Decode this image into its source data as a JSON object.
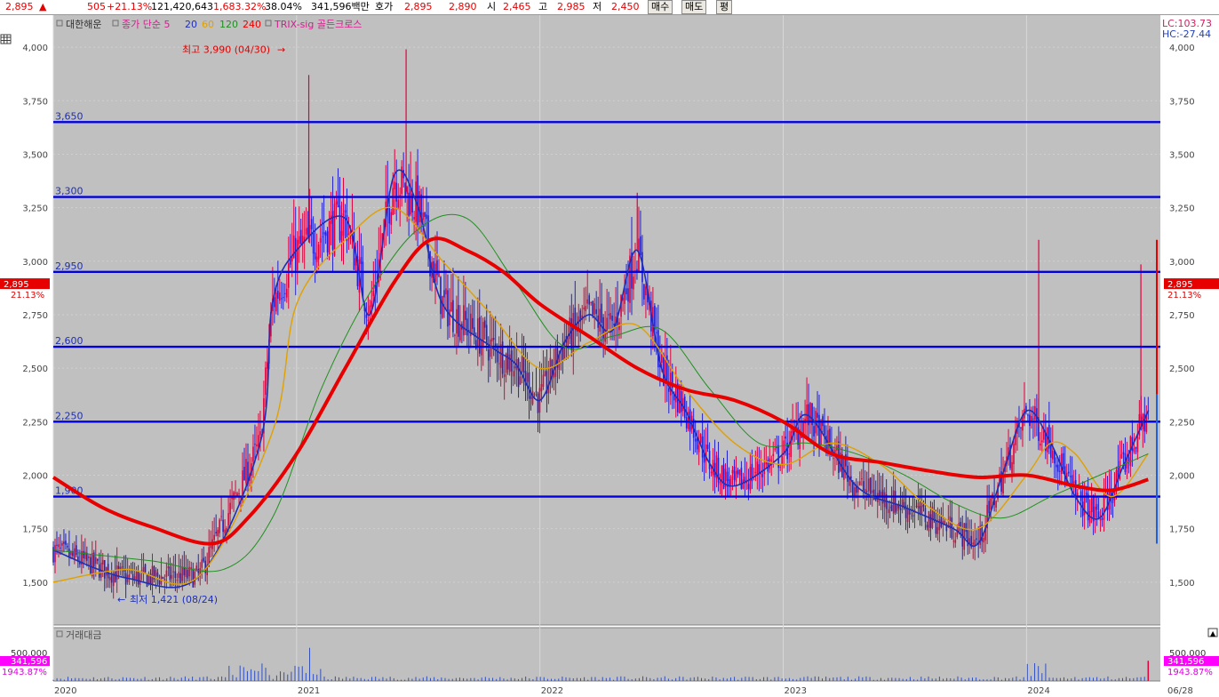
{
  "topbar": {
    "price": "2,895",
    "arrow": "▲",
    "change": "505",
    "change_pct": "+21.13%",
    "volume": "121,420,643",
    "volume_pct": "1,683.32%",
    "turnover": "38.04%",
    "amount": "341,596백만",
    "quote_label": "호가",
    "ask": "2,895",
    "bid": "2,890",
    "open_label": "시",
    "open": "2,465",
    "high_label": "고",
    "high": "2,985",
    "low_label": "저",
    "low": "2,450",
    "buy_button": "매수",
    "sell_button": "매도",
    "eval_button": "평"
  },
  "legend": {
    "stock_name": "대한해운",
    "ma_label": "종가 단순 5",
    "ma20": "20",
    "ma60": "60",
    "ma120": "120",
    "ma240": "240",
    "indicator": "TRIX-sig 골든크로스"
  },
  "right_info": {
    "lc": "LC:103.73",
    "hc": "HC:-27.44"
  },
  "current_tag": {
    "price": "2,895",
    "pct": "21.13%"
  },
  "volume_panel": {
    "title": "거래대금",
    "tick": "500,000",
    "current": "341,596",
    "pct": "1943.87%"
  },
  "annotations": {
    "high_label": "최고 3,990 (04/30)",
    "low_label": "최저 1,421 (08/24)"
  },
  "colors": {
    "background": "#c0c0c0",
    "candle_up": "#e0003c",
    "candle_down": "#2020d0",
    "ma5": "#1e2fb5",
    "ma20": "#e0a000",
    "ma60": "#209020",
    "ma240": "#e80000",
    "hline": "#0000e0",
    "tag": "#e60000"
  },
  "chart_data": {
    "type": "line",
    "title": "대한해운",
    "x_ticks": [
      "2020",
      "2021",
      "2022",
      "2023",
      "2024",
      "06/28"
    ],
    "y_ticks": [
      "4,000",
      "3,750",
      "3,500",
      "3,250",
      "3,000",
      "2,750",
      "2,500",
      "2,250",
      "2,000",
      "1,750",
      "1,500"
    ],
    "ylim": [
      1300,
      4150
    ],
    "horizontal_lines": [
      3650,
      3300,
      2950,
      2600,
      2250,
      1900
    ],
    "horizontal_line_labels": [
      "3,650",
      "3,300",
      "2,950",
      "2,600",
      "2,250",
      "1,900"
    ],
    "grid": true,
    "legend_position": "top-left",
    "series": [
      {
        "name": "종가 단순 5",
        "x": [
          2020.0,
          2020.3,
          2020.6,
          2020.85,
          2020.9,
          2021.0,
          2021.2,
          2021.3,
          2021.4,
          2021.5,
          2021.6,
          2021.8,
          2021.9,
          2022.0,
          2022.1,
          2022.2,
          2022.3,
          2022.4,
          2022.5,
          2022.6,
          2022.7,
          2022.8,
          2023.0,
          2023.1,
          2023.3,
          2023.5,
          2023.7,
          2023.8,
          2023.9,
          2024.0,
          2024.1,
          2024.2,
          2024.3,
          2024.4,
          2024.5
        ],
        "values": [
          1650,
          1520,
          1530,
          2150,
          2800,
          3050,
          3200,
          2750,
          3400,
          3250,
          2800,
          2600,
          2520,
          2350,
          2620,
          2750,
          2680,
          3050,
          2500,
          2300,
          2050,
          1950,
          2100,
          2280,
          1950,
          1850,
          1750,
          1680,
          2000,
          2300,
          2150,
          1900,
          1800,
          2050,
          2300
        ]
      },
      {
        "name": "60",
        "x": [
          2020.0,
          2020.3,
          2020.6,
          2020.9,
          2021.0,
          2021.2,
          2021.4,
          2021.6,
          2021.8,
          2022.0,
          2022.2,
          2022.4,
          2022.6,
          2022.8,
          2023.0,
          2023.2,
          2023.4,
          2023.6,
          2023.8,
          2024.0,
          2024.1,
          2024.2,
          2024.35,
          2024.5
        ],
        "values": [
          1500,
          1560,
          1530,
          2200,
          2800,
          3100,
          3250,
          3000,
          2750,
          2500,
          2620,
          2700,
          2400,
          2150,
          2050,
          2150,
          2050,
          1850,
          1750,
          2000,
          2150,
          2100,
          1900,
          2100
        ]
      },
      {
        "name": "120",
        "x": [
          2020.0,
          2020.4,
          2020.7,
          2020.9,
          2021.1,
          2021.3,
          2021.5,
          2021.7,
          2021.9,
          2022.1,
          2022.3,
          2022.5,
          2022.7,
          2022.9,
          2023.1,
          2023.3,
          2023.5,
          2023.7,
          2023.9,
          2024.1,
          2024.3,
          2024.5
        ],
        "values": [
          1650,
          1600,
          1560,
          1800,
          2400,
          2850,
          3150,
          3200,
          2900,
          2600,
          2650,
          2680,
          2400,
          2150,
          2150,
          2100,
          2000,
          1870,
          1800,
          1900,
          2000,
          2100
        ]
      },
      {
        "name": "240",
        "x": [
          2020.0,
          2020.2,
          2020.4,
          2020.65,
          2020.8,
          2021.0,
          2021.2,
          2021.4,
          2021.55,
          2021.7,
          2021.85,
          2022.0,
          2022.2,
          2022.4,
          2022.6,
          2022.8,
          2023.0,
          2023.2,
          2023.4,
          2023.6,
          2023.8,
          2024.0,
          2024.2,
          2024.35,
          2024.5
        ],
        "values": [
          1990,
          1850,
          1760,
          1680,
          1800,
          2100,
          2500,
          2900,
          3100,
          3050,
          2950,
          2800,
          2650,
          2500,
          2400,
          2350,
          2250,
          2100,
          2060,
          2020,
          1990,
          2000,
          1950,
          1930,
          1980
        ]
      }
    ],
    "volume": {
      "ylim": [
        0,
        900000
      ],
      "ticks": [
        "500,000"
      ],
      "last": 341596
    }
  }
}
